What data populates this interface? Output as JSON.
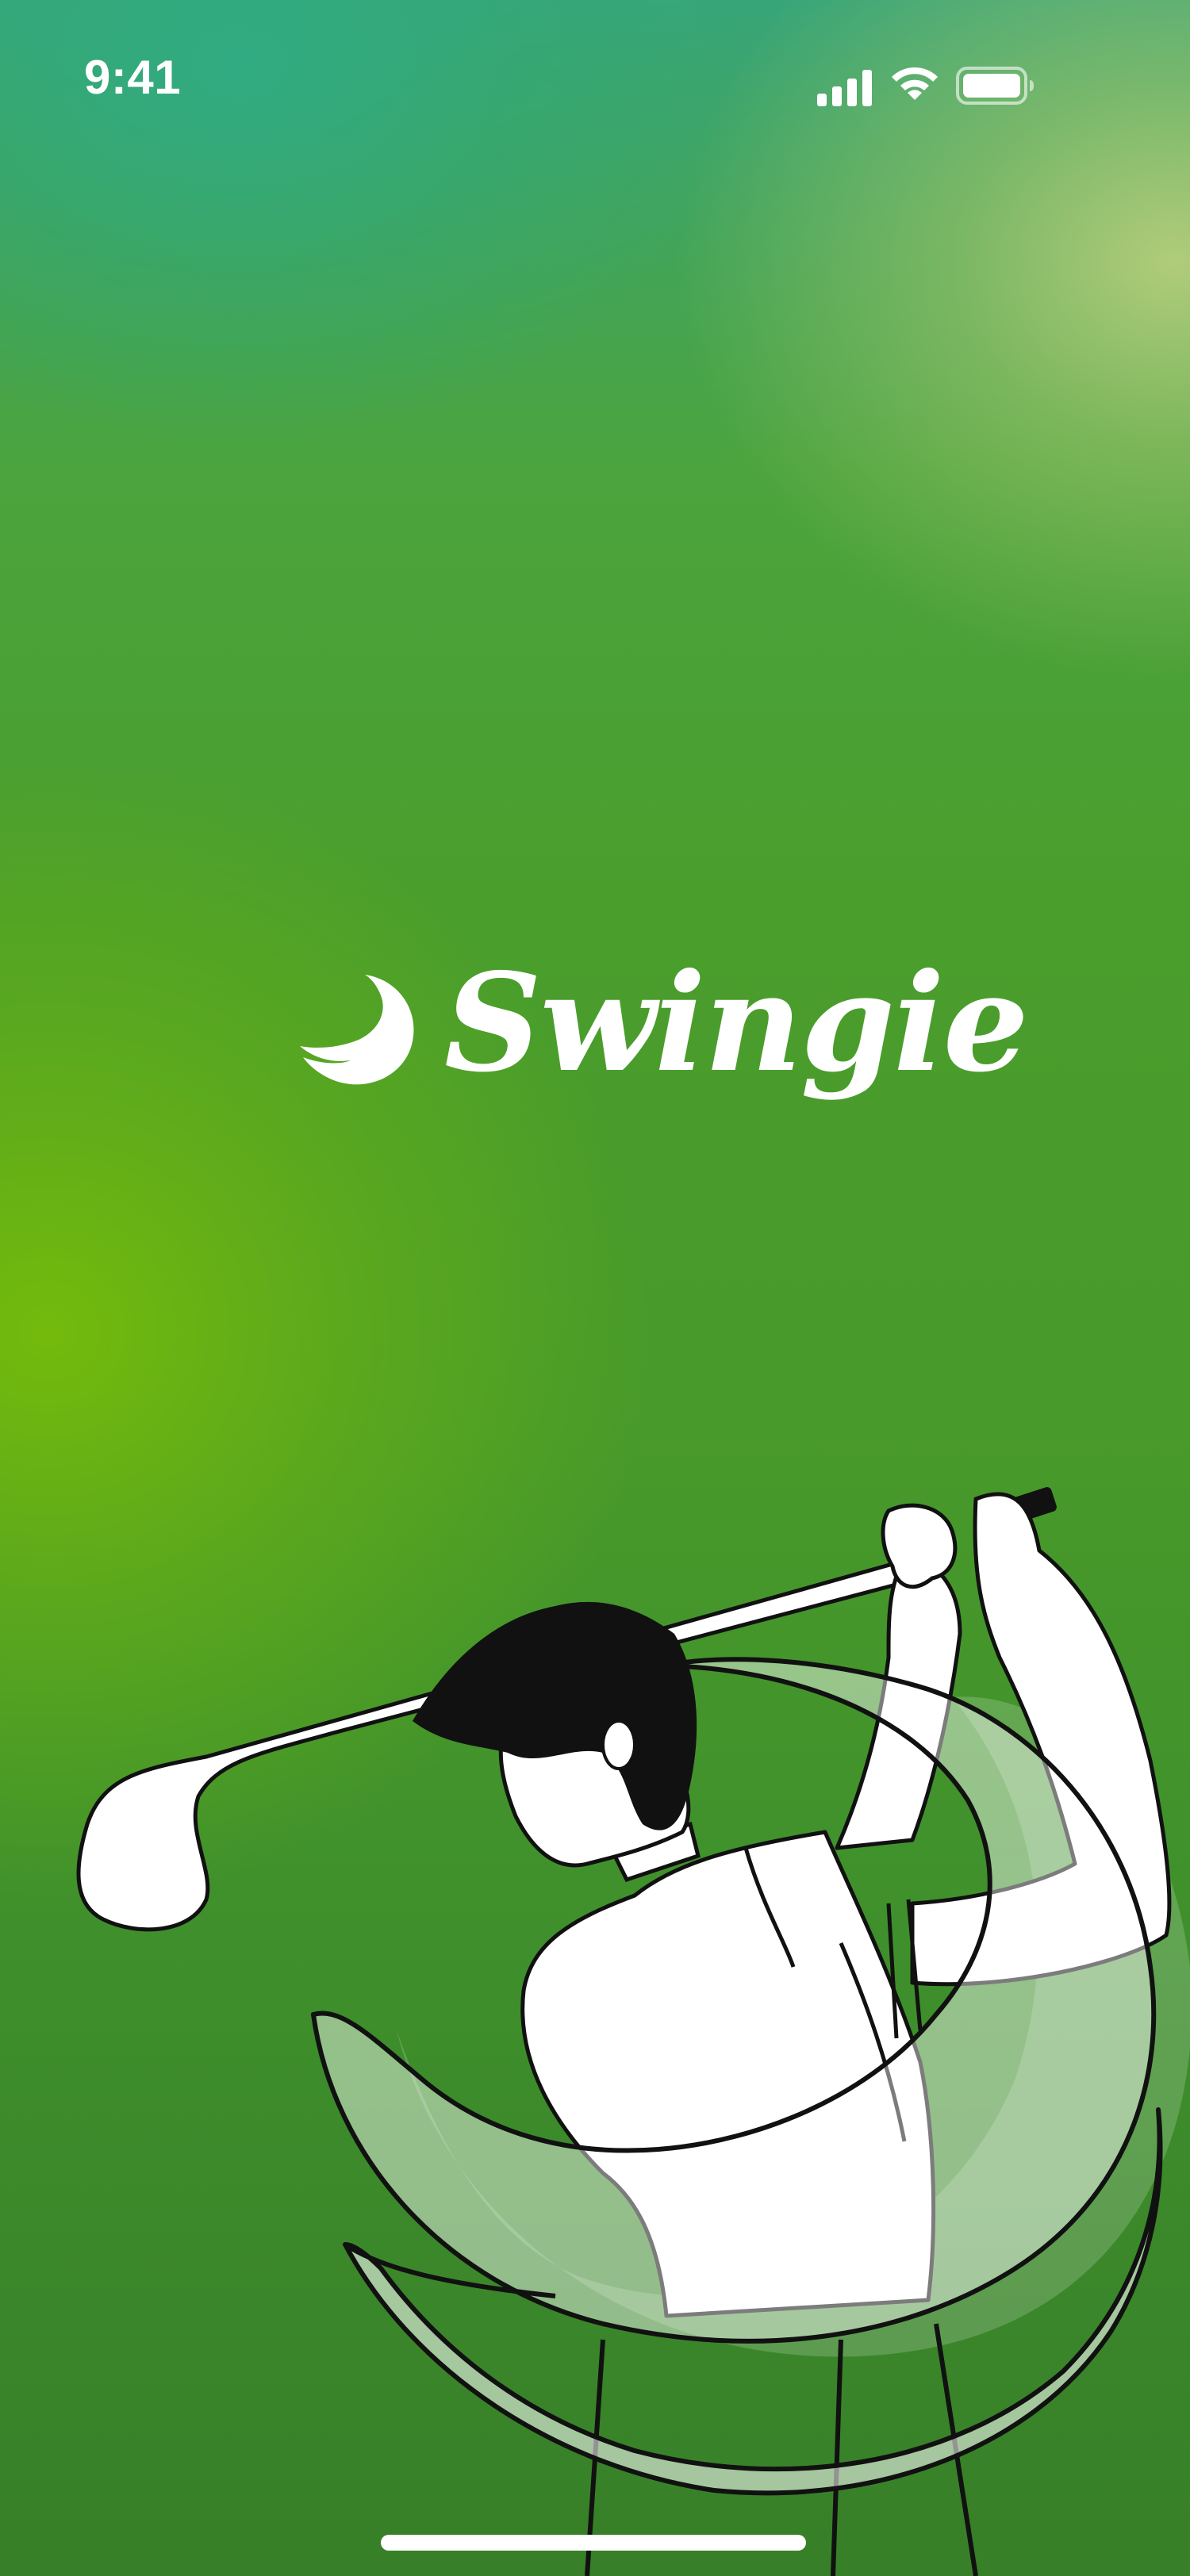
{
  "status_bar": {
    "time": "9:41",
    "icons": [
      "cellular-signal-icon",
      "wifi-icon",
      "battery-icon"
    ]
  },
  "brand": {
    "name": "Swingie",
    "logo_icon": "crescent-swoosh-icon",
    "text_color": "#ffffff"
  },
  "illustration": {
    "subject": "golfer-swing-illustration"
  },
  "colors": {
    "background_top": "#38a578",
    "background_mid": "#489a2a",
    "background_bottom": "#377f28",
    "accent_light": "#b6ce7c",
    "accent_lime": "#76bc0a"
  }
}
